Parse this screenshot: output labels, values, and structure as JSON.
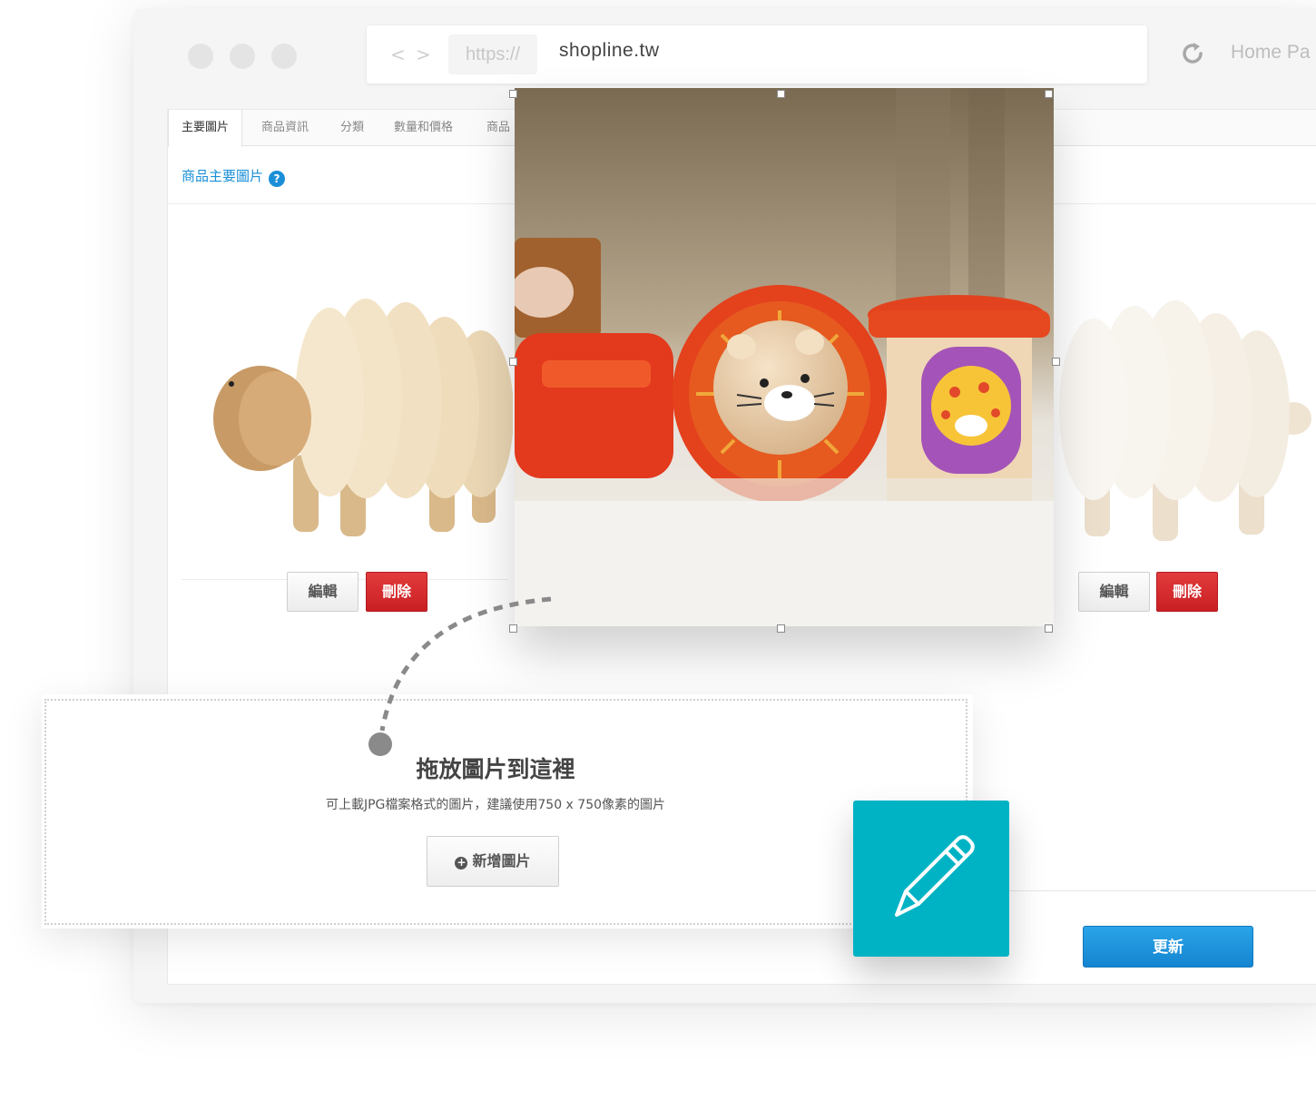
{
  "browser": {
    "back_glyph": "<",
    "forward_glyph": ">",
    "protocol": "https://",
    "domain": "shopline.tw",
    "home_link": "Home Pa"
  },
  "tabs": [
    {
      "label": "主要圖片"
    },
    {
      "label": "商品資訊"
    },
    {
      "label": "分類"
    },
    {
      "label": "數量和價格"
    },
    {
      "label": "商品"
    }
  ],
  "section": {
    "title": "商品主要圖片",
    "help_glyph": "?"
  },
  "cards": [
    {
      "edit_label": "編輯",
      "delete_label": "刪除"
    },
    {
      "edit_label": "編輯",
      "delete_label": "刪除"
    }
  ],
  "dropzone": {
    "title": "拖放圖片到這裡",
    "hint": "可上載JPG檔案格式的圖片，建議使用750 x 750像素的圖片",
    "add_label": "新增圖片",
    "add_glyph": "+"
  },
  "update_label": "更新",
  "colors": {
    "accent_blue": "#1a8fd8",
    "delete_red": "#c91f24",
    "teal_tile": "#00b3c4"
  },
  "icons": [
    "refresh-icon",
    "help-icon",
    "plus-circle-icon",
    "pencil-icon"
  ]
}
